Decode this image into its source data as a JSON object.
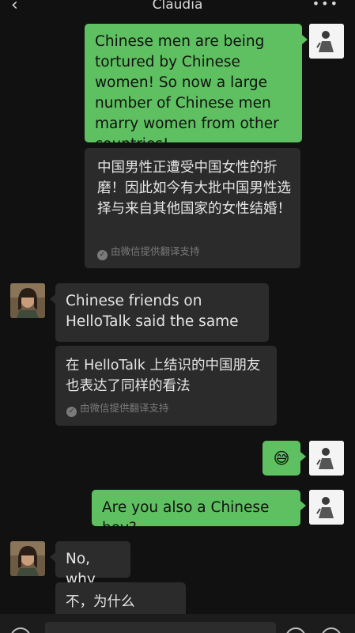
{
  "header": {
    "back_icon": "chevron-left-icon",
    "title": "Claudia",
    "more_icon": "more-dots-icon",
    "more_glyph": "•••"
  },
  "messages": [
    {
      "side": "right",
      "text": "Chinese men are being tortured by Chinese women! So now a large number of Chinese men marry women from other countries!",
      "translation": "中国男性正遭受中国女性的折磨！因此如今有大批中国男性选择与来自其他国家的女性结婚！",
      "credit": "由微信提供翻译支持"
    },
    {
      "side": "left",
      "text": "Chinese friends on HelloTalk said the same",
      "translation": "在 HelloTalk 上结识的中国朋友也表达了同样的看法",
      "credit": "由微信提供翻译支持"
    },
    {
      "side": "right",
      "emoji": "😅"
    },
    {
      "side": "right",
      "text": "Are you also a Chinese boy?"
    },
    {
      "side": "left",
      "text": "No, why",
      "translation": "不，为什么"
    }
  ],
  "colors": {
    "background": "#111111",
    "my_bubble": "#5ec060",
    "their_bubble": "#2c2c2c",
    "translation_box": "#2b2b2b",
    "credit_text": "#7a7a7a"
  }
}
